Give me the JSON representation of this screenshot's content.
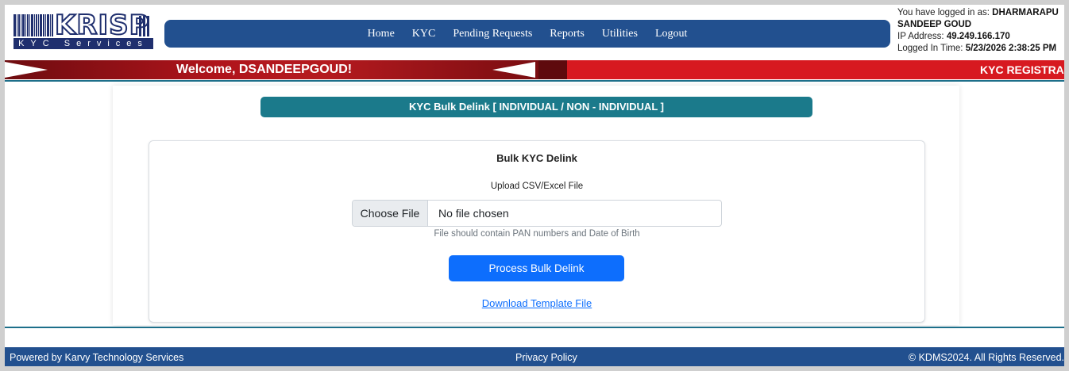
{
  "logo": {
    "brand": "KRISP",
    "tagline": "KYC Services"
  },
  "nav": [
    "Home",
    "KYC",
    "Pending Requests",
    "Reports",
    "Utilities",
    "Logout"
  ],
  "login": {
    "prefix": "You have logged in as:",
    "user": "DHARMARAPU SANDEEP GOUD",
    "ip_label": "IP Address:",
    "ip": "49.249.166.170",
    "time_label": "Logged In Time:",
    "time": "5/23/2026 2:38:25 PM"
  },
  "banner": {
    "welcome": "Welcome, DSANDEEPGOUD!",
    "marquee": "KYC REGISTRA"
  },
  "page": {
    "title": "KYC Bulk Delink [ INDIVIDUAL / NON - INDIVIDUAL ]",
    "card_title": "Bulk KYC Delink",
    "upload_label": "Upload CSV/Excel File",
    "choose_file": "Choose File",
    "no_file": "No file chosen",
    "help": "File should contain PAN numbers and Date of Birth",
    "process_button": "Process Bulk Delink",
    "download_link": "Download Template File"
  },
  "footer": {
    "left": "Powered by Karvy Technology Services",
    "middle": "Privacy Policy",
    "right": "© KDMS2024. All Rights Reserved."
  },
  "colors": {
    "nav": "#22508f",
    "banner_red": "#d71920",
    "teal": "#1b7a8b",
    "primary": "#0d6efd"
  }
}
